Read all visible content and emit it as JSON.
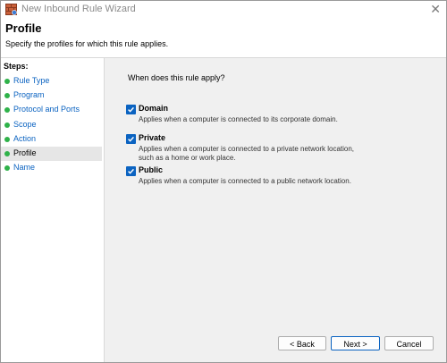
{
  "window": {
    "title": "New Inbound Rule Wizard",
    "close_glyph": "✕"
  },
  "header": {
    "title": "Profile",
    "subtitle": "Specify the profiles for which this rule applies."
  },
  "sidebar": {
    "title": "Steps:",
    "items": [
      {
        "label": "Rule Type"
      },
      {
        "label": "Program"
      },
      {
        "label": "Protocol and Ports"
      },
      {
        "label": "Scope"
      },
      {
        "label": "Action"
      },
      {
        "label": "Profile"
      },
      {
        "label": "Name"
      }
    ],
    "active_index": 5
  },
  "main": {
    "question": "When does this rule apply?",
    "options": [
      {
        "label": "Domain",
        "checked": true,
        "description": "Applies when a computer is connected to its corporate domain."
      },
      {
        "label": "Private",
        "checked": true,
        "description": "Applies when a computer is connected to a private network location, such as a home or work place."
      },
      {
        "label": "Public",
        "checked": true,
        "description": "Applies when a computer is connected to a public network location."
      }
    ]
  },
  "buttons": {
    "back": "< Back",
    "next": "Next >",
    "cancel": "Cancel"
  },
  "colors": {
    "accent": "#0b63c1",
    "step_dot": "#2fb24a"
  }
}
